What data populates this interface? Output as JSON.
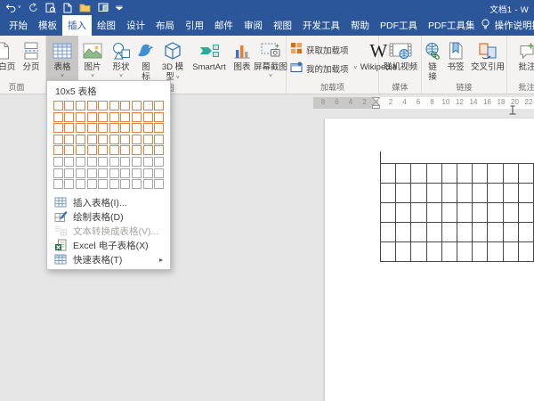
{
  "colors": {
    "titlebar_blue": "#2b579a",
    "selection_orange": "#e8823b",
    "ribbon_bg": "#f4f3f1",
    "pressed_gray": "#c8c6c4"
  },
  "titlebar": {
    "title": "文档1 - W",
    "qat": [
      "undo",
      "redo",
      "print-preview",
      "new-document",
      "open-folder",
      "touch-mode",
      "customize-qat"
    ]
  },
  "tabbar": {
    "tabs": [
      {
        "label": "开始"
      },
      {
        "label": "模板"
      },
      {
        "label": "插入",
        "active": true
      },
      {
        "label": "绘图"
      },
      {
        "label": "设计"
      },
      {
        "label": "布局"
      },
      {
        "label": "引用"
      },
      {
        "label": "邮件"
      },
      {
        "label": "审阅"
      },
      {
        "label": "视图"
      },
      {
        "label": "开发工具"
      },
      {
        "label": "帮助"
      },
      {
        "label": "PDF工具"
      },
      {
        "label": "PDF工具集"
      }
    ],
    "tell_me": "操作说明搜索"
  },
  "ribbon": {
    "groups": [
      {
        "label": "页面",
        "buttons": [
          {
            "label": "空白页",
            "icon": "blank-page"
          },
          {
            "label": "分页",
            "icon": "page-break"
          }
        ]
      },
      {
        "label": "插图",
        "buttons": [
          {
            "label": "表格",
            "icon": "table",
            "chevron": "below",
            "pressed": true
          },
          {
            "label": "图片",
            "icon": "picture",
            "chevron": "below"
          },
          {
            "label": "形状",
            "icon": "shapes",
            "chevron": "below"
          },
          {
            "label": "图\n标",
            "icon": "icons"
          },
          {
            "label": "3D 模\n型",
            "icon": "model3d",
            "chevron": "inline"
          },
          {
            "label": "SmartArt",
            "icon": "smartart"
          },
          {
            "label": "图表",
            "icon": "chart"
          },
          {
            "label": "屏幕截图",
            "icon": "screenshot",
            "chevron": "below"
          }
        ]
      },
      {
        "label": "加载项",
        "stack": [
          {
            "label": "获取加载项",
            "icon": "get-addins"
          },
          {
            "label": "我的加载项",
            "icon": "my-addins",
            "chevron": "inline"
          }
        ],
        "buttons": [
          {
            "label": "Wikipedia",
            "icon": "wikipedia"
          }
        ]
      },
      {
        "label": "媒体",
        "buttons": [
          {
            "label": "联机视频",
            "icon": "online-video"
          }
        ]
      },
      {
        "label": "链接",
        "buttons": [
          {
            "label": "链\n接",
            "icon": "link"
          },
          {
            "label": "书签",
            "icon": "bookmark"
          },
          {
            "label": "交叉引用",
            "icon": "crossref"
          }
        ]
      },
      {
        "label": "批注",
        "buttons": [
          {
            "label": "批注",
            "icon": "comment"
          }
        ]
      }
    ]
  },
  "table_dropdown": {
    "header": "10x5 表格",
    "grid": {
      "cols": 10,
      "rows": 8,
      "selected_cols": 10,
      "selected_rows": 5
    },
    "menu": [
      {
        "label": "插入表格(I)...",
        "icon": "m-insert-table"
      },
      {
        "label": "绘制表格(D)",
        "icon": "m-draw-table"
      },
      {
        "label": "文本转换成表格(V)...",
        "icon": "m-convert",
        "disabled": true
      },
      {
        "label": "Excel 电子表格(X)",
        "icon": "m-excel"
      },
      {
        "label": "快速表格(T)",
        "icon": "m-quick",
        "submenu": true
      }
    ]
  },
  "ruler": {
    "margin_numbers": [
      "8",
      "6",
      "4",
      "2"
    ],
    "numbers": [
      "2",
      "4",
      "6",
      "8",
      "10",
      "12",
      "14",
      "16",
      "18",
      "20",
      "22"
    ]
  },
  "document": {
    "table": {
      "rows": 5,
      "cols": 10
    }
  }
}
